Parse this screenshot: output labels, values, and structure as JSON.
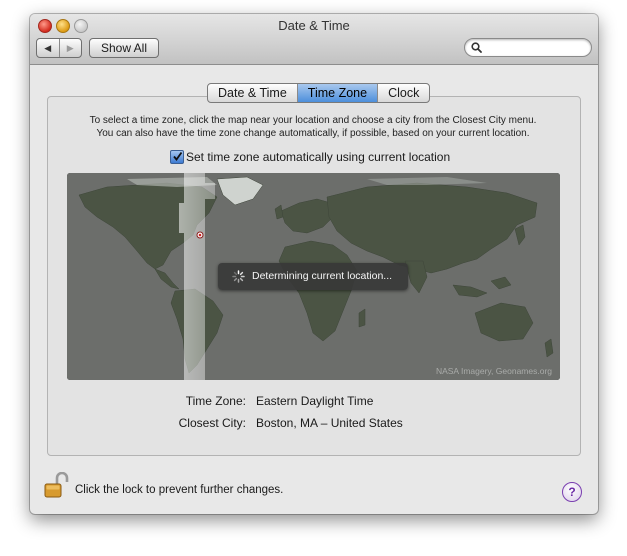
{
  "window": {
    "title": "Date & Time"
  },
  "toolbar": {
    "back_icon": "◀",
    "forward_icon": "▶",
    "show_all_label": "Show All",
    "search_value": ""
  },
  "tabs": [
    {
      "label": "Date & Time",
      "active": false
    },
    {
      "label": "Time Zone",
      "active": true
    },
    {
      "label": "Clock",
      "active": false
    }
  ],
  "instructions": {
    "line1": "To select a time zone, click the map near your location and choose a city from the Closest City menu.",
    "line2": "You can also have the time zone change automatically, if possible, based on your current location."
  },
  "auto_timezone": {
    "label": "Set time zone automatically using current location",
    "checked": true
  },
  "map": {
    "status_text": "Determining current location...",
    "credit": "NASA Imagery, Geonames.org"
  },
  "info": {
    "time_zone_label": "Time Zone:",
    "time_zone_value": "Eastern Daylight Time",
    "closest_city_label": "Closest City:",
    "closest_city_value": "Boston, MA – United States"
  },
  "lock": {
    "text": "Click the lock to prevent further changes."
  },
  "help": {
    "symbol": "?"
  }
}
